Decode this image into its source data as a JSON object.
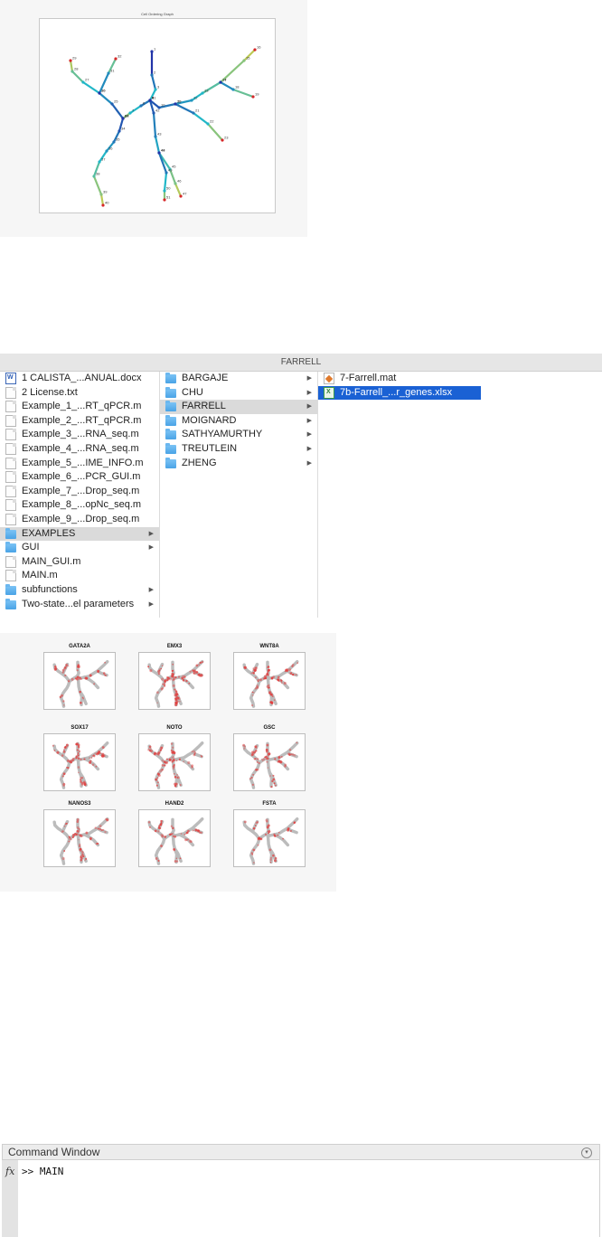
{
  "graph_figure": {
    "title": "Cell Ordering Graph",
    "node_labels": [
      "1",
      "2",
      "3",
      "4",
      "5",
      "6",
      "7",
      "8",
      "9",
      "10",
      "11",
      "12",
      "13",
      "14",
      "15",
      "16",
      "17",
      "18",
      "19",
      "20",
      "21",
      "22",
      "23",
      "24",
      "25",
      "26",
      "27",
      "28",
      "29",
      "30",
      "31",
      "32",
      "33",
      "34",
      "35",
      "36",
      "37",
      "38",
      "39",
      "40",
      "41",
      "42",
      "43",
      "44",
      "45",
      "46",
      "47",
      "48",
      "49",
      "50",
      "51",
      "52",
      "53",
      "54",
      "55",
      "56",
      "57",
      "58",
      "59",
      "60",
      "61",
      "62",
      "63",
      "64",
      "65",
      "66",
      "67",
      "68",
      "69",
      "70",
      "71",
      "72",
      "73",
      "74",
      "75",
      "76",
      "77",
      "78",
      "79"
    ],
    "colors": {
      "low": "#2234a8",
      "mid": "#22b7c7",
      "high": "#f0d030",
      "node": "#d62728"
    }
  },
  "finder": {
    "window_title": "FARRELL",
    "column1": [
      {
        "label": "1 CALISTA_...ANUAL.docx",
        "icon": "word-doc-icon",
        "arrow": false,
        "selected": ""
      },
      {
        "label": "2 License.txt",
        "icon": "text-file-icon",
        "arrow": false,
        "selected": ""
      },
      {
        "label": "Example_1_...RT_qPCR.m",
        "icon": "text-file-icon",
        "arrow": false,
        "selected": ""
      },
      {
        "label": "Example_2_...RT_qPCR.m",
        "icon": "text-file-icon",
        "arrow": false,
        "selected": ""
      },
      {
        "label": "Example_3_...RNA_seq.m",
        "icon": "text-file-icon",
        "arrow": false,
        "selected": ""
      },
      {
        "label": "Example_4_...RNA_seq.m",
        "icon": "text-file-icon",
        "arrow": false,
        "selected": ""
      },
      {
        "label": "Example_5_...IME_INFO.m",
        "icon": "text-file-icon",
        "arrow": false,
        "selected": ""
      },
      {
        "label": "Example_6_...PCR_GUI.m",
        "icon": "text-file-icon",
        "arrow": false,
        "selected": ""
      },
      {
        "label": "Example_7_...Drop_seq.m",
        "icon": "text-file-icon",
        "arrow": false,
        "selected": ""
      },
      {
        "label": "Example_8_...opNc_seq.m",
        "icon": "text-file-icon",
        "arrow": false,
        "selected": ""
      },
      {
        "label": "Example_9_...Drop_seq.m",
        "icon": "text-file-icon",
        "arrow": false,
        "selected": ""
      },
      {
        "label": "EXAMPLES",
        "icon": "folder-icon",
        "arrow": true,
        "selected": "gray"
      },
      {
        "label": "GUI",
        "icon": "folder-icon",
        "arrow": true,
        "selected": ""
      },
      {
        "label": "MAIN_GUI.m",
        "icon": "text-file-icon",
        "arrow": false,
        "selected": ""
      },
      {
        "label": "MAIN.m",
        "icon": "text-file-icon",
        "arrow": false,
        "selected": ""
      },
      {
        "label": "subfunctions",
        "icon": "folder-icon",
        "arrow": true,
        "selected": ""
      },
      {
        "label": "Two-state...el parameters",
        "icon": "folder-icon",
        "arrow": true,
        "selected": ""
      }
    ],
    "column2": [
      {
        "label": "BARGAJE",
        "icon": "folder-icon",
        "arrow": true,
        "selected": ""
      },
      {
        "label": "CHU",
        "icon": "folder-icon",
        "arrow": true,
        "selected": ""
      },
      {
        "label": "FARRELL",
        "icon": "folder-icon",
        "arrow": true,
        "selected": "gray"
      },
      {
        "label": "MOIGNARD",
        "icon": "folder-icon",
        "arrow": true,
        "selected": ""
      },
      {
        "label": "SATHYAMURTHY",
        "icon": "folder-icon",
        "arrow": true,
        "selected": ""
      },
      {
        "label": "TREUTLEIN",
        "icon": "folder-icon",
        "arrow": true,
        "selected": ""
      },
      {
        "label": "ZHENG",
        "icon": "folder-icon",
        "arrow": true,
        "selected": ""
      }
    ],
    "column3": [
      {
        "label": "7-Farrell.mat",
        "icon": "mat-file-icon",
        "arrow": false,
        "selected": ""
      },
      {
        "label": "7b-Farrell_...r_genes.xlsx",
        "icon": "excel-file-icon",
        "arrow": false,
        "selected": "blue"
      }
    ]
  },
  "genes": {
    "titles": [
      "GATA2A",
      "EMX3",
      "WNT8A",
      "SOX17",
      "NOTO",
      "GSC",
      "NANOS3",
      "HAND2",
      "FSTA"
    ]
  },
  "command_window": {
    "title": "Command Window",
    "prompt_icon": "fx",
    "line": ">> MAIN"
  }
}
